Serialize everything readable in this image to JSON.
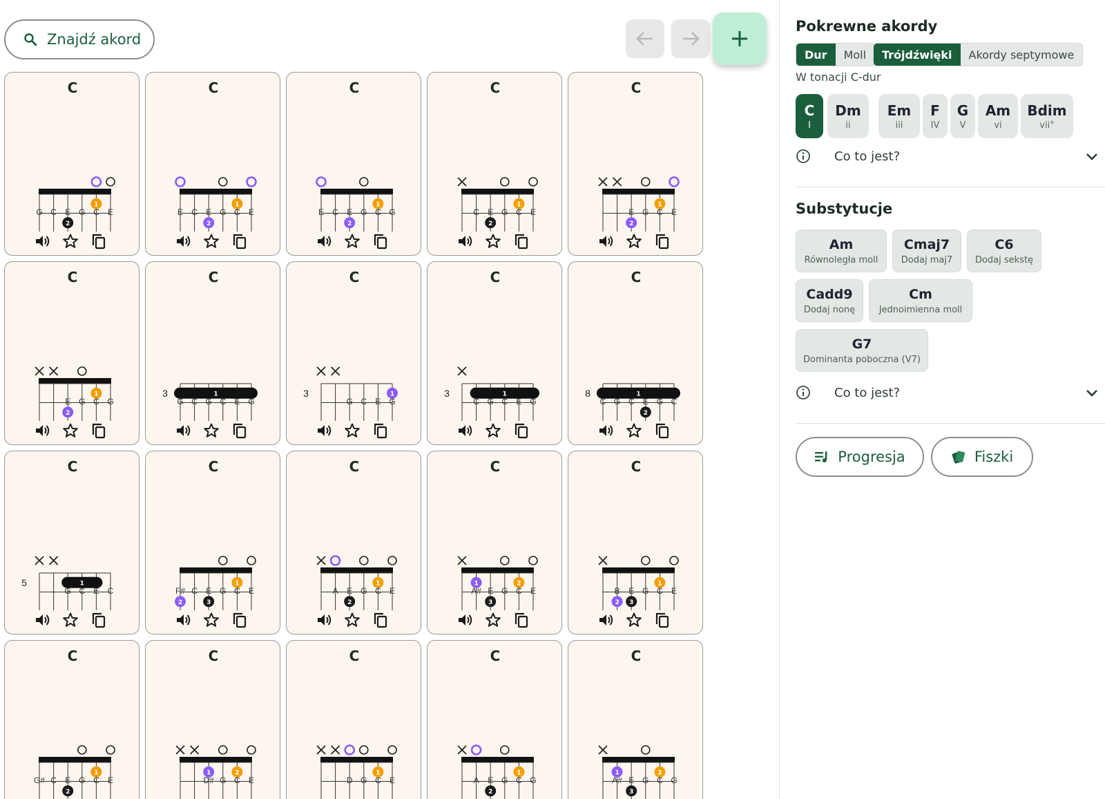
{
  "toolbar": {
    "search_label": "Znajdź akord"
  },
  "colors": {
    "accent": "#1b5e3c",
    "finger1": "#f29f05",
    "finger2": "#8b5cf6",
    "finger_other": "#1a1a1a",
    "open_root": "#8b5cf6"
  },
  "chords": [
    {
      "name": "C",
      "fret_label": "",
      "markers": [
        "",
        "",
        "",
        "",
        "R",
        "O"
      ],
      "barre": null,
      "dots": [
        [
          6,
          3,
          "3",
          "p"
        ],
        [
          5,
          3,
          "4",
          "o"
        ],
        [
          4,
          2,
          "2",
          "b"
        ],
        [
          2,
          1,
          "1",
          "o"
        ]
      ],
      "notes": [
        "G",
        "C",
        "E",
        "G",
        "C",
        "E"
      ]
    },
    {
      "name": "C",
      "fret_label": "",
      "markers": [
        "R",
        "",
        "",
        "O",
        "",
        "R"
      ],
      "barre": null,
      "dots": [
        [
          5,
          3,
          "3",
          "o"
        ],
        [
          4,
          2,
          "2",
          "p"
        ],
        [
          2,
          1,
          "1",
          "o"
        ]
      ],
      "notes": [
        "E",
        "C",
        "E",
        "G",
        "C",
        "E"
      ]
    },
    {
      "name": "C",
      "fret_label": "",
      "markers": [
        "R",
        "",
        "",
        "O",
        "",
        ""
      ],
      "barre": null,
      "dots": [
        [
          5,
          3,
          "3",
          "o"
        ],
        [
          4,
          2,
          "2",
          "p"
        ],
        [
          2,
          1,
          "1",
          "o"
        ],
        [
          1,
          3,
          "4",
          "b"
        ]
      ],
      "notes": [
        "E",
        "C",
        "E",
        "G",
        "C",
        "G"
      ]
    },
    {
      "name": "C",
      "fret_label": "",
      "markers": [
        "X",
        "",
        "",
        "O",
        "",
        "O"
      ],
      "barre": null,
      "dots": [
        [
          5,
          3,
          "3",
          "o"
        ],
        [
          4,
          2,
          "2",
          "b"
        ],
        [
          2,
          1,
          "1",
          "o"
        ]
      ],
      "notes": [
        "",
        "C",
        "E",
        "G",
        "C",
        "E"
      ]
    },
    {
      "name": "C",
      "fret_label": "",
      "markers": [
        "X",
        "X",
        "",
        "O",
        "",
        "R"
      ],
      "barre": null,
      "dots": [
        [
          4,
          2,
          "2",
          "p"
        ],
        [
          2,
          1,
          "1",
          "o"
        ]
      ],
      "notes": [
        "",
        "",
        "E",
        "G",
        "C",
        "E"
      ]
    },
    {
      "name": "C",
      "fret_label": "",
      "markers": [
        "X",
        "X",
        "",
        "O",
        "",
        ""
      ],
      "barre": null,
      "dots": [
        [
          4,
          2,
          "2",
          "p"
        ],
        [
          2,
          1,
          "1",
          "o"
        ],
        [
          1,
          3,
          "3",
          "b"
        ]
      ],
      "notes": [
        "",
        "",
        "E",
        "G",
        "C",
        "G"
      ]
    },
    {
      "name": "C",
      "fret_label": "3",
      "markers": [
        "",
        "",
        "",
        "",
        "",
        ""
      ],
      "barre": [
        1,
        6,
        1
      ],
      "dots": [
        [
          4,
          3,
          "2",
          "p"
        ],
        [
          3,
          3,
          "3",
          "o"
        ],
        [
          2,
          3,
          "4",
          "b"
        ]
      ],
      "notes": [
        "G",
        "C",
        "G",
        "C",
        "E",
        "G"
      ]
    },
    {
      "name": "C",
      "fret_label": "3",
      "markers": [
        "X",
        "X",
        "",
        "",
        "",
        ""
      ],
      "barre": null,
      "dots": [
        [
          1,
          1,
          "1",
          "p"
        ],
        [
          4,
          3,
          "2",
          "p"
        ],
        [
          3,
          3,
          "3",
          "o"
        ],
        [
          2,
          3,
          "4",
          "b"
        ]
      ],
      "notes": [
        "",
        "",
        "G",
        "C",
        "E",
        "G"
      ]
    },
    {
      "name": "C",
      "fret_label": "3",
      "markers": [
        "X",
        "",
        "",
        "",
        "",
        ""
      ],
      "barre": [
        1,
        5,
        1
      ],
      "dots": [
        [
          4,
          3,
          "2",
          "b"
        ],
        [
          3,
          3,
          "3",
          "o"
        ],
        [
          2,
          3,
          "4",
          "b"
        ]
      ],
      "notes": [
        "",
        "C",
        "G",
        "C",
        "E",
        "G"
      ]
    },
    {
      "name": "C",
      "fret_label": "8",
      "markers": [
        "",
        "",
        "",
        "",
        "",
        ""
      ],
      "barre": [
        1,
        6,
        1
      ],
      "dots": [
        [
          3,
          2,
          "2",
          "b"
        ],
        [
          5,
          3,
          "3",
          "b"
        ],
        [
          4,
          3,
          "4",
          "o"
        ]
      ],
      "notes": [
        "C",
        "G",
        "C",
        "E",
        "G",
        "C"
      ]
    },
    {
      "name": "C",
      "fret_label": "5",
      "markers": [
        "X",
        "X",
        "",
        "",
        "",
        ""
      ],
      "barre": [
        2,
        4,
        1
      ],
      "dots": [
        [
          1,
          4,
          "4",
          "o"
        ]
      ],
      "notes": [
        "",
        "",
        "G",
        "C",
        "E",
        "C"
      ]
    },
    {
      "name": "C",
      "fret_label": "",
      "markers": [
        "",
        "",
        "",
        "O",
        "",
        "O"
      ],
      "barre": null,
      "dots": [
        [
          6,
          2,
          "2",
          "p"
        ],
        [
          5,
          3,
          "4",
          "o"
        ],
        [
          4,
          2,
          "3",
          "b"
        ],
        [
          2,
          1,
          "1",
          "o"
        ]
      ],
      "notes": [
        "F#",
        "C",
        "E",
        "G",
        "C",
        "E"
      ]
    },
    {
      "name": "C",
      "fret_label": "",
      "markers": [
        "X",
        "R",
        "",
        "O",
        "",
        "O"
      ],
      "barre": null,
      "dots": [
        [
          4,
          2,
          "2",
          "b"
        ],
        [
          2,
          1,
          "1",
          "o"
        ]
      ],
      "notes": [
        "",
        "A",
        "E",
        "G",
        "C",
        "E"
      ]
    },
    {
      "name": "C",
      "fret_label": "",
      "markers": [
        "X",
        "",
        "",
        "O",
        "",
        "O"
      ],
      "barre": null,
      "dots": [
        [
          5,
          1,
          "1",
          "p"
        ],
        [
          2,
          1,
          "2",
          "o"
        ],
        [
          4,
          2,
          "3",
          "b"
        ]
      ],
      "notes": [
        "",
        "A#",
        "E",
        "G",
        "C",
        "E"
      ]
    },
    {
      "name": "C",
      "fret_label": "",
      "markers": [
        "X",
        "",
        "",
        "O",
        "",
        "O"
      ],
      "barre": null,
      "dots": [
        [
          5,
          2,
          "2",
          "p"
        ],
        [
          4,
          2,
          "3",
          "b"
        ],
        [
          2,
          1,
          "1",
          "o"
        ]
      ],
      "notes": [
        "",
        "B",
        "E",
        "G",
        "C",
        "E"
      ]
    },
    {
      "name": "C",
      "fret_label": "",
      "markers": [
        "",
        "",
        "",
        "O",
        "",
        "O"
      ],
      "barre": null,
      "dots": [
        [
          6,
          4,
          "4",
          "p"
        ],
        [
          5,
          3,
          "3",
          "o"
        ],
        [
          4,
          2,
          "2",
          "b"
        ],
        [
          2,
          1,
          "1",
          "o"
        ]
      ],
      "notes": [
        "G#",
        "C",
        "E",
        "G",
        "C",
        "E"
      ]
    },
    {
      "name": "C",
      "fret_label": "",
      "markers": [
        "X",
        "X",
        "",
        "O",
        "",
        "O"
      ],
      "barre": null,
      "dots": [
        [
          4,
          1,
          "1",
          "p"
        ],
        [
          2,
          1,
          "2",
          "o"
        ]
      ],
      "notes": [
        "",
        "",
        "D#",
        "G",
        "C",
        "E"
      ]
    },
    {
      "name": "C",
      "fret_label": "",
      "markers": [
        "X",
        "X",
        "R",
        "O",
        "",
        "O"
      ],
      "barre": null,
      "dots": [
        [
          2,
          1,
          "1",
          "o"
        ]
      ],
      "notes": [
        "",
        "",
        "D",
        "G",
        "C",
        "E"
      ]
    },
    {
      "name": "C",
      "fret_label": "",
      "markers": [
        "X",
        "R",
        "",
        "O",
        "",
        ""
      ],
      "barre": null,
      "dots": [
        [
          4,
          2,
          "2",
          "b"
        ],
        [
          2,
          1,
          "1",
          "o"
        ],
        [
          1,
          3,
          "3",
          "b"
        ]
      ],
      "notes": [
        "",
        "A",
        "E",
        "G",
        "C",
        "G"
      ]
    },
    {
      "name": "C",
      "fret_label": "",
      "markers": [
        "X",
        "",
        "",
        "O",
        "",
        ""
      ],
      "barre": null,
      "dots": [
        [
          5,
          1,
          "1",
          "p"
        ],
        [
          4,
          2,
          "3",
          "b"
        ],
        [
          2,
          1,
          "2",
          "o"
        ],
        [
          1,
          3,
          "4",
          "b"
        ]
      ],
      "notes": [
        "",
        "A#",
        "E",
        "G",
        "C",
        "G"
      ]
    }
  ],
  "related": {
    "title": "Pokrewne akordy",
    "mode_options": [
      "Dur",
      "Moll"
    ],
    "mode_selected": "Dur",
    "type_options": [
      "Trójdźwięki",
      "Akordy septymowe"
    ],
    "type_selected": "Trójdźwięki",
    "key_label": "W tonacji C-dur",
    "degrees": [
      {
        "name": "C",
        "roman": "I",
        "selected": true
      },
      {
        "name": "Dm",
        "roman": "ii",
        "selected": false
      },
      {
        "name": "Em",
        "roman": "iii",
        "selected": false
      },
      {
        "name": "F",
        "roman": "IV",
        "selected": false
      },
      {
        "name": "G",
        "roman": "V",
        "selected": false
      },
      {
        "name": "Am",
        "roman": "vi",
        "selected": false
      },
      {
        "name": "Bdim",
        "roman": "vii°",
        "selected": false
      }
    ],
    "info_label": "Co to jest?"
  },
  "substitutions": {
    "title": "Substytucje",
    "items": [
      {
        "name": "Am",
        "desc": "Równoległa moll"
      },
      {
        "name": "Cmaj7",
        "desc": "Dodaj maj7"
      },
      {
        "name": "C6",
        "desc": "Dodaj sekstę"
      },
      {
        "name": "Cadd9",
        "desc": "Dodaj nonę"
      },
      {
        "name": "Cm",
        "desc": "Jednoimienna moll"
      },
      {
        "name": "G7",
        "desc": "Dominanta poboczna (V7)"
      }
    ],
    "info_label": "Co to jest?"
  },
  "actions": {
    "progression_label": "Progresja",
    "flashcards_label": "Fiszki"
  }
}
